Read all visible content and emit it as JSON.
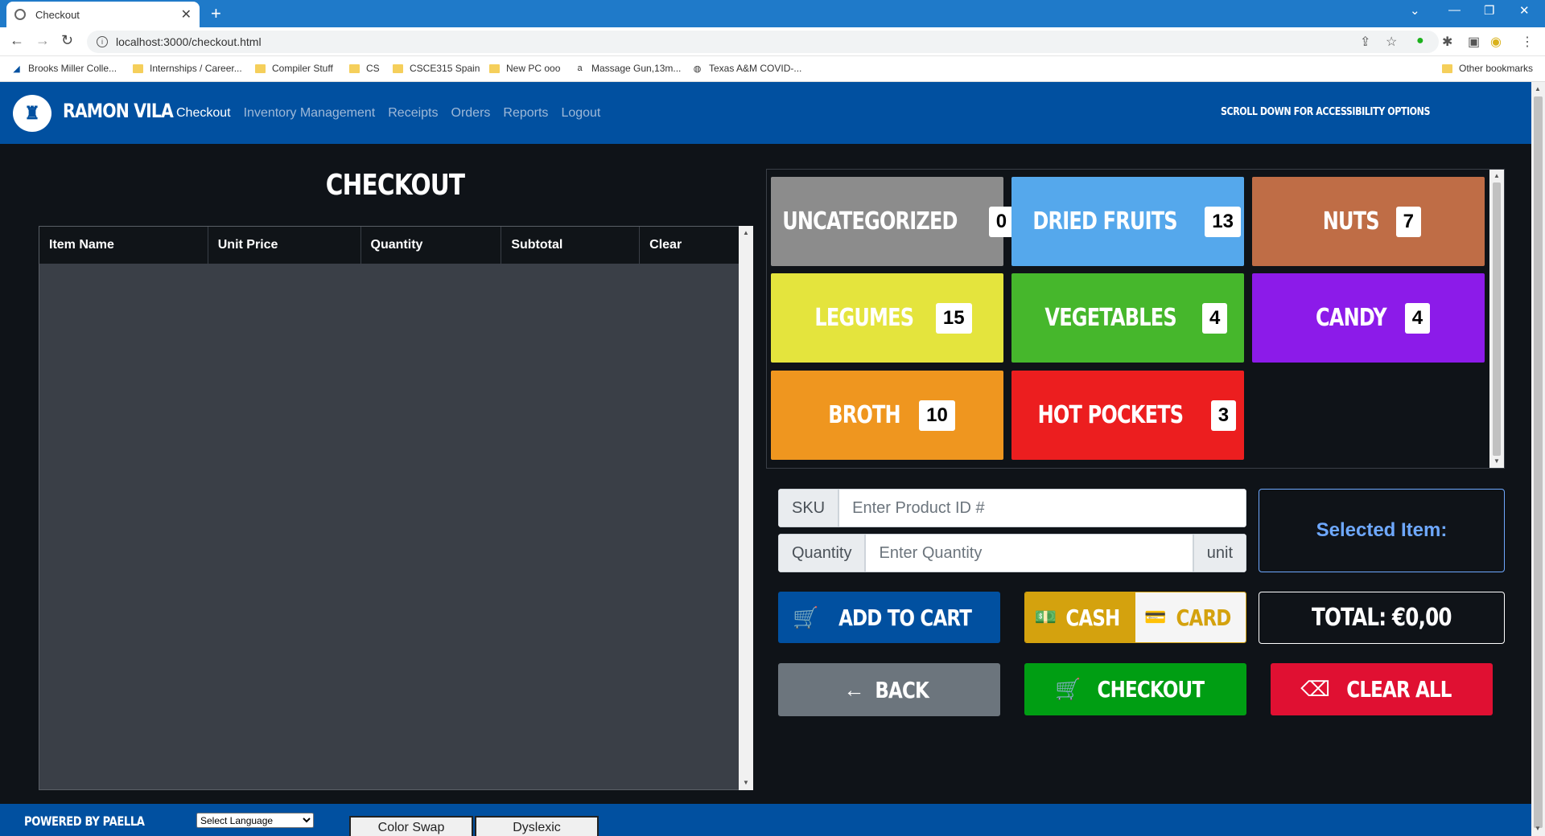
{
  "browser": {
    "tab_title": "Checkout",
    "new_tab": "+",
    "url": "localhost:3000/checkout.html",
    "bookmarks": [
      "Brooks Miller Colle...",
      "Internships / Career...",
      "Compiler Stuff",
      "CS",
      "CSCE315 Spain",
      "New PC ooo",
      "Massage Gun,13m...",
      "Texas A&M COVID-..."
    ],
    "other_bookmarks": "Other bookmarks"
  },
  "header": {
    "brand": "RAMON VILA",
    "nav": [
      "Checkout",
      "Inventory Management",
      "Receipts",
      "Orders",
      "Reports",
      "Logout"
    ],
    "accessibility_note": "SCROLL DOWN FOR ACCESSIBILITY OPTIONS"
  },
  "cart": {
    "title": "CHECKOUT",
    "columns": [
      "Item Name",
      "Unit Price",
      "Quantity",
      "Subtotal",
      "Clear"
    ]
  },
  "categories": [
    {
      "name": "UNCATEGORIZED",
      "count": "0",
      "color": "#8c8c8c"
    },
    {
      "name": "DRIED FRUITS",
      "count": "13",
      "color": "#55a8ec"
    },
    {
      "name": "NUTS",
      "count": "7",
      "color": "#bf6d46"
    },
    {
      "name": "LEGUMES",
      "count": "15",
      "color": "#e4e43d"
    },
    {
      "name": "VEGETABLES",
      "count": "4",
      "color": "#46b72c"
    },
    {
      "name": "CANDY",
      "count": "4",
      "color": "#8c1be9"
    },
    {
      "name": "BROTH",
      "count": "10",
      "color": "#ef961f"
    },
    {
      "name": "HOT POCKETS",
      "count": "3",
      "color": "#ec1e1f"
    }
  ],
  "form": {
    "sku_label": "SKU",
    "sku_placeholder": "Enter Product ID #",
    "quantity_label": "Quantity",
    "quantity_placeholder": "Enter Quantity",
    "unit_label": "unit",
    "selected_item": "Selected Item:"
  },
  "actions": {
    "add_to_cart": "ADD TO CART",
    "cash": "CASH",
    "card": "CARD",
    "total": "TOTAL: €0,00",
    "back": "BACK",
    "checkout": "CHECKOUT",
    "clear_all": "CLEAR ALL"
  },
  "footer": {
    "powered_by": "POWERED BY PAELLA",
    "language_select": "Select Language",
    "color_swap": "Color Swap",
    "dyslexic": "Dyslexic"
  },
  "colors": {
    "header_blue": "#0150a0",
    "page_bg": "#0f1318",
    "add_to_cart": "#0150a0",
    "cash": "#d4a20e",
    "back": "#6c757d",
    "checkout": "#009e13",
    "clear_all": "#e01032"
  }
}
